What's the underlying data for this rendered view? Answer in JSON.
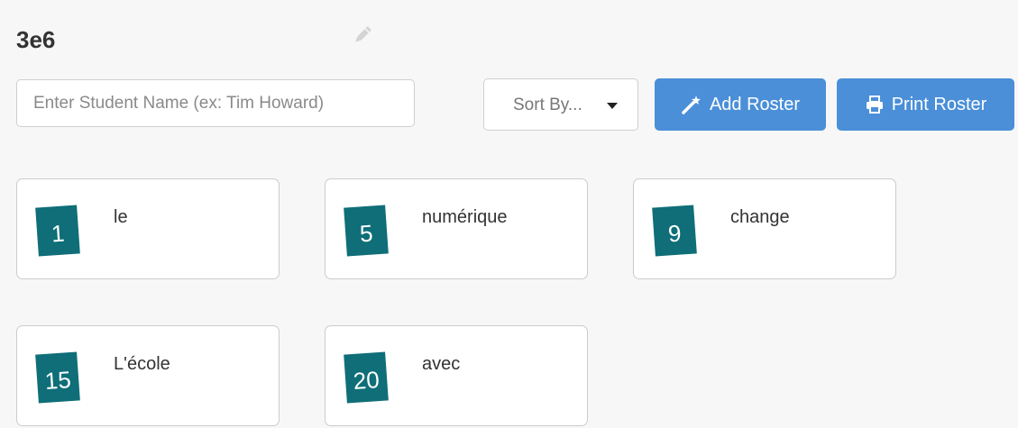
{
  "header": {
    "title": "3e6",
    "edit_icon": "pencil-icon"
  },
  "toolbar": {
    "search_placeholder": "Enter Student Name (ex: Tim Howard)",
    "search_value": "",
    "sort_label": "Sort By...",
    "add_roster_label": "Add Roster",
    "add_roster_icon": "magic-wand-icon",
    "print_roster_label": "Print Roster",
    "print_roster_icon": "printer-icon"
  },
  "colors": {
    "accent": "#4a8fd8",
    "badge": "#0f6e78",
    "background": "#f7f7f7"
  },
  "students": [
    {
      "number": "1",
      "name": "le"
    },
    {
      "number": "5",
      "name": "numérique"
    },
    {
      "number": "9",
      "name": "change"
    },
    {
      "number": "15",
      "name": "L'école"
    },
    {
      "number": "20",
      "name": "avec"
    }
  ]
}
